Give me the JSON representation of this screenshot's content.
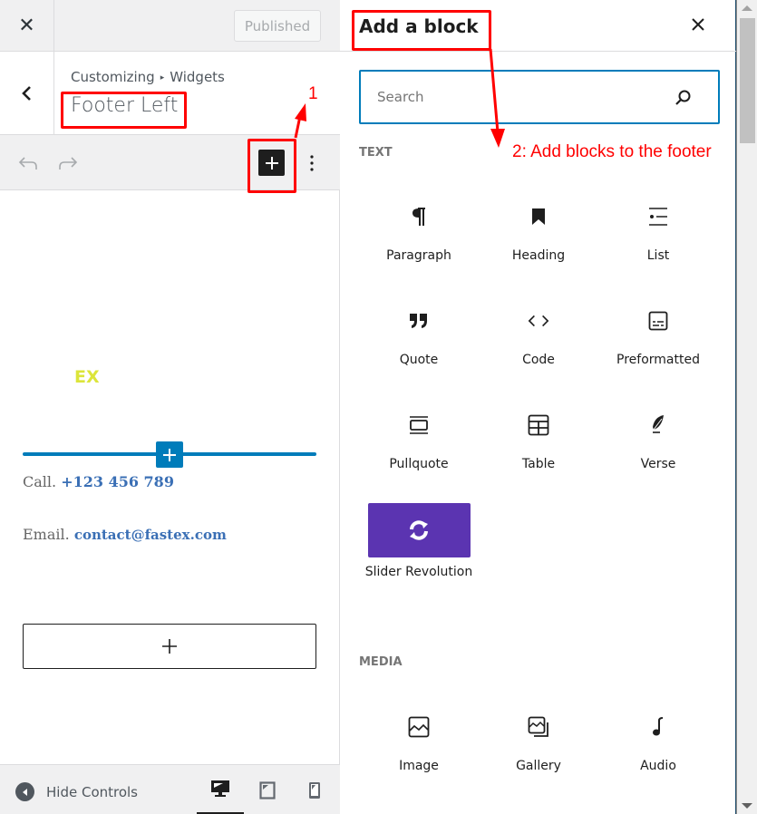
{
  "customizer": {
    "close_label": "✕",
    "published_label": "Published",
    "breadcrumb": [
      "Customizing",
      "Widgets"
    ],
    "breadcrumb_separator": "▸",
    "section_title": "Footer Left",
    "toolbar": {
      "undo_icon": "undo-icon",
      "redo_icon": "redo-icon",
      "inserter_icon": "plus-icon",
      "options_icon": "more-vertical-icon"
    },
    "preview": {
      "logo_text": "EX",
      "call_label": "Call.",
      "call_value": "+123 456 789",
      "email_label": "Email.",
      "email_value": "contact@fastex.com"
    },
    "footer": {
      "hide_controls_label": "Hide Controls",
      "devices": [
        {
          "name": "desktop",
          "active": true
        },
        {
          "name": "tablet",
          "active": false
        },
        {
          "name": "mobile",
          "active": false
        }
      ]
    }
  },
  "inserter": {
    "title": "Add a block",
    "close_label": "✕",
    "search_placeholder": "Search",
    "categories": [
      {
        "name": "TEXT",
        "blocks": [
          {
            "label": "Paragraph",
            "icon": "paragraph-icon"
          },
          {
            "label": "Heading",
            "icon": "bookmark-icon"
          },
          {
            "label": "List",
            "icon": "list-icon"
          },
          {
            "label": "Quote",
            "icon": "quote-icon"
          },
          {
            "label": "Code",
            "icon": "code-icon"
          },
          {
            "label": "Preformatted",
            "icon": "preformatted-icon"
          },
          {
            "label": "Pullquote",
            "icon": "pullquote-icon"
          },
          {
            "label": "Table",
            "icon": "table-icon"
          },
          {
            "label": "Verse",
            "icon": "feather-icon"
          },
          {
            "label": "Slider Revolution",
            "icon": "refresh-icon"
          }
        ]
      },
      {
        "name": "MEDIA",
        "blocks": [
          {
            "label": "Image",
            "icon": "image-icon"
          },
          {
            "label": "Gallery",
            "icon": "gallery-icon"
          },
          {
            "label": "Audio",
            "icon": "audio-icon"
          }
        ]
      }
    ]
  },
  "annotations": {
    "step1": "1",
    "step2": "2: Add blocks to the footer"
  },
  "colors": {
    "accent": "#007cba",
    "annotation": "#ff0000",
    "slider_revolution": "#5b34b1",
    "logo": "#dce53a"
  }
}
